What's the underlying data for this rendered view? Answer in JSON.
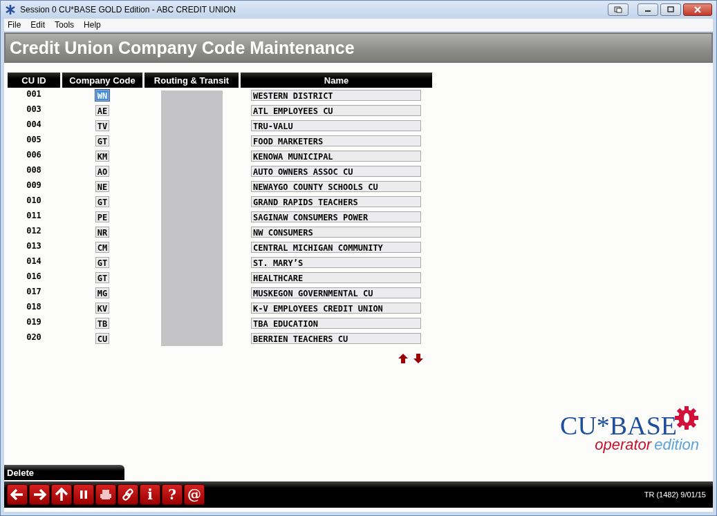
{
  "window": {
    "title": "Session 0 CU*BASE GOLD Edition - ABC CREDIT UNION"
  },
  "menu": [
    "File",
    "Edit",
    "Tools",
    "Help"
  ],
  "header": "Credit Union Company Code Maintenance",
  "table": {
    "columns": [
      "CU ID",
      "Company Code",
      "Routing & Transit",
      "Name"
    ],
    "rows": [
      {
        "cu_id": "001",
        "company_code": "WN",
        "focused": true,
        "name": "WESTERN DISTRICT"
      },
      {
        "cu_id": "003",
        "company_code": "AE",
        "focused": false,
        "name": "ATL EMPLOYEES CU"
      },
      {
        "cu_id": "004",
        "company_code": "TV",
        "focused": false,
        "name": "TRU-VALU"
      },
      {
        "cu_id": "005",
        "company_code": "GT",
        "focused": false,
        "name": "FOOD MARKETERS"
      },
      {
        "cu_id": "006",
        "company_code": "KM",
        "focused": false,
        "name": "KENOWA MUNICIPAL"
      },
      {
        "cu_id": "008",
        "company_code": "AO",
        "focused": false,
        "name": "AUTO OWNERS ASSOC CU"
      },
      {
        "cu_id": "009",
        "company_code": "NE",
        "focused": false,
        "name": "NEWAYGO COUNTY SCHOOLS CU"
      },
      {
        "cu_id": "010",
        "company_code": "GT",
        "focused": false,
        "name": "GRAND RAPIDS TEACHERS"
      },
      {
        "cu_id": "011",
        "company_code": "PE",
        "focused": false,
        "name": "SAGINAW CONSUMERS POWER"
      },
      {
        "cu_id": "012",
        "company_code": "NR",
        "focused": false,
        "name": "NW CONSUMERS"
      },
      {
        "cu_id": "013",
        "company_code": "CM",
        "focused": false,
        "name": "CENTRAL MICHIGAN COMMUNITY"
      },
      {
        "cu_id": "014",
        "company_code": "GT",
        "focused": false,
        "name": "ST. MARY’S"
      },
      {
        "cu_id": "016",
        "company_code": "GT",
        "focused": false,
        "name": "HEALTHCARE"
      },
      {
        "cu_id": "017",
        "company_code": "MG",
        "focused": false,
        "name": "MUSKEGON GOVERNMENTAL CU"
      },
      {
        "cu_id": "018",
        "company_code": "KV",
        "focused": false,
        "name": "K-V EMPLOYEES CREDIT UNION"
      },
      {
        "cu_id": "019",
        "company_code": "TB",
        "focused": false,
        "name": "TBA EDUCATION"
      },
      {
        "cu_id": "020",
        "company_code": "CU",
        "focused": false,
        "name": "BERRIEN TEACHERS CU"
      }
    ]
  },
  "logo": {
    "brand": "CU*BASE",
    "word1": "operator",
    "word2": "edition"
  },
  "action_tab": "Delete",
  "toolbar": [
    {
      "kind": "back"
    },
    {
      "kind": "forward"
    },
    {
      "kind": "up"
    },
    {
      "kind": "pause"
    },
    {
      "kind": "print"
    },
    {
      "kind": "link"
    },
    {
      "kind": "glyph",
      "glyph": "i"
    },
    {
      "kind": "glyph",
      "glyph": "?"
    },
    {
      "kind": "glyph",
      "glyph": "@"
    }
  ],
  "status": "TR (1482) 9/01/15"
}
